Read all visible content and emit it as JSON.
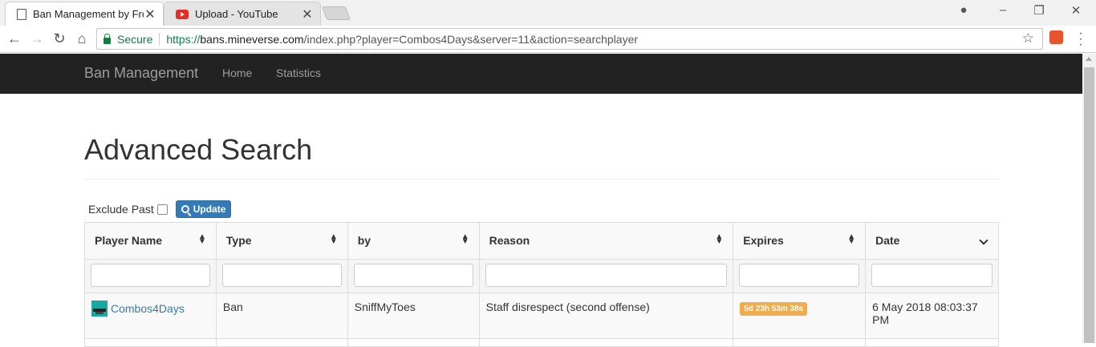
{
  "browser": {
    "tabs": [
      {
        "title": "Ban Management by Fros",
        "icon": "page-icon",
        "active": true
      },
      {
        "title": "Upload - YouTube",
        "icon": "youtube-icon",
        "active": false
      }
    ],
    "security_label": "Secure",
    "url_scheme": "https://",
    "url_host": "bans.mineverse.com",
    "url_path": "/index.php?player=Combos4Days&server=11&action=searchplayer"
  },
  "navbar": {
    "brand": "Ban Management",
    "links": [
      "Home",
      "Statistics"
    ]
  },
  "page": {
    "title": "Advanced Search",
    "exclude_past_label": "Exclude Past",
    "update_label": "Update"
  },
  "table": {
    "headers": [
      "Player Name",
      "Type",
      "by",
      "Reason",
      "Expires",
      "Date"
    ],
    "rows": [
      {
        "player": "Combos4Days",
        "type": "Ban",
        "by": "SniffMyToes",
        "reason": "Staff disrespect (second offense)",
        "expires": "5d 23h 53m 38s",
        "date": "6 May 2018 08:03:37 PM"
      }
    ]
  },
  "colors": {
    "navbar_bg": "#222222",
    "link": "#337ab7",
    "badge_warning": "#f0ad4e",
    "button_primary": "#337ab7"
  }
}
